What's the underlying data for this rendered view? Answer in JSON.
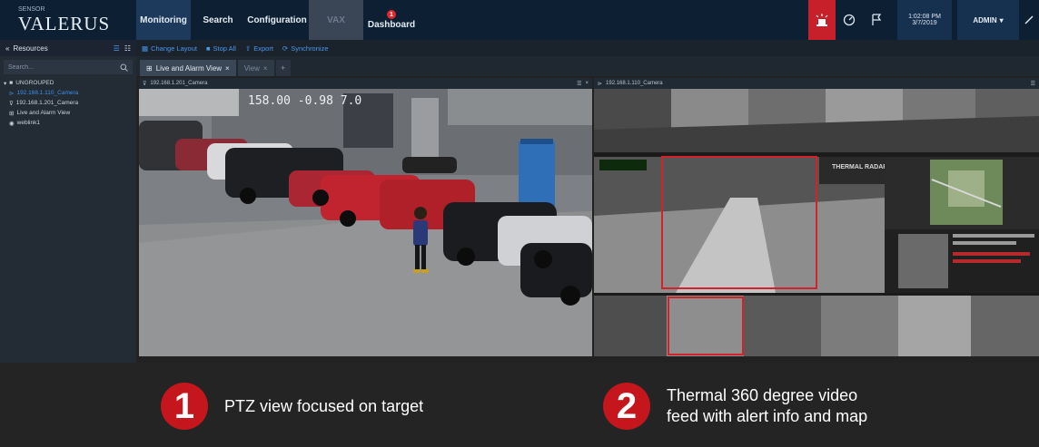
{
  "app": {
    "brand_small": "SENSOR",
    "name": "VALERUS"
  },
  "nav": {
    "items": [
      {
        "label": "Monitoring"
      },
      {
        "label": "Search"
      },
      {
        "label": "Configuration"
      },
      {
        "label": "VAX"
      }
    ],
    "dashboard": {
      "label": "Dashboard",
      "badge": "1"
    }
  },
  "header": {
    "time": "1:02:08 PM",
    "date": "3/7/2019",
    "user": "ADMIN"
  },
  "sidebar": {
    "title": "Resources",
    "search_placeholder": "Search...",
    "group": "UNGROUPED",
    "items": [
      {
        "label": "192.168.1.110_Camera"
      },
      {
        "label": "192.168.1.201_Camera"
      },
      {
        "label": "Live and Alarm View"
      },
      {
        "label": "weblink1"
      }
    ]
  },
  "toolbar": {
    "change_layout": "Change Layout",
    "stop_all": "Stop All",
    "export": "Export",
    "synchronize": "Synchronize"
  },
  "tabs": [
    {
      "label": "Live and Alarm View"
    },
    {
      "label": "View"
    }
  ],
  "panes": {
    "left": {
      "name": "192.168.1.201_Camera",
      "overlay": "158.00 -0.98 7.0"
    },
    "right": {
      "name": "192.168.1.110_Camera",
      "radar_label": "THERMAL RADAR"
    }
  },
  "captions": [
    {
      "number": "1",
      "text": "PTZ view focused on target"
    },
    {
      "number": "2",
      "line1": "Thermal  360 degree video",
      "line2": "feed with alert info and map"
    }
  ],
  "colors": {
    "accent": "#3d8ee8",
    "alert": "#c8202a",
    "caption_badge": "#c4161c"
  }
}
